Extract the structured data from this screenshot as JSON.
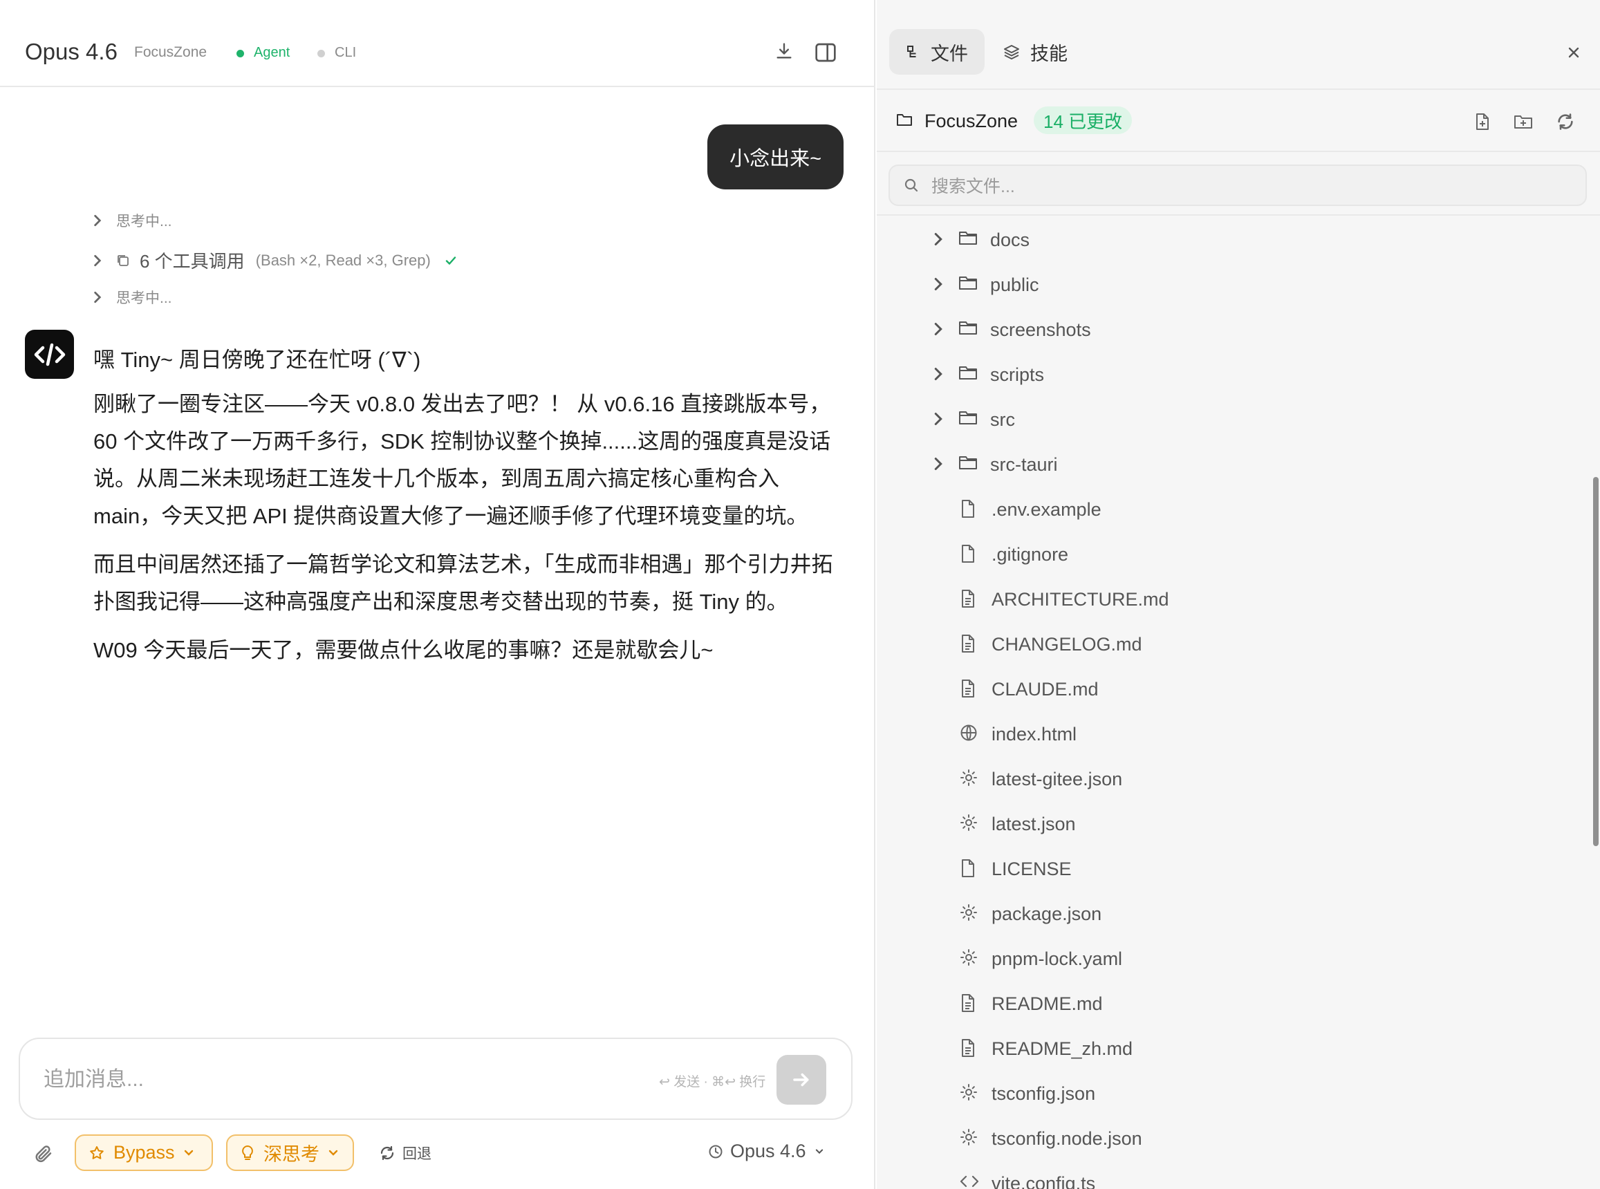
{
  "header": {
    "model": "Opus 4.6",
    "project": "FocusZone",
    "mode_agent": "Agent",
    "mode_cli": "CLI",
    "agent_color": "#1fb36b"
  },
  "conversation": {
    "user_message": "小念出来~",
    "trace": {
      "thinking_1": "思考中...",
      "tools_label": "6 个工具调用",
      "tools_detail": "(Bash ×2, Read ×3, Grep)",
      "thinking_2": "思考中..."
    },
    "assistant_paragraphs": [
      "嘿 Tiny~ 周日傍晚了还在忙呀 (´∇`)",
      "刚瞅了一圈专注区——今天 v0.8.0 发出去了吧？！ 从 v0.6.16 直接跳版本号，60 个文件改了一万两千多行，SDK 控制协议整个换掉......这周的强度真是没话说。从周二米未现场赶工连发十几个版本，到周五周六搞定核心重构合入 main，今天又把 API 提供商设置大修了一遍还顺手修了代理环境变量的坑。",
      "而且中间居然还插了一篇哲学论文和算法艺术，「生成而非相遇」那个引力井拓扑图我记得——这种高强度产出和深度思考交替出现的节奏，挺 Tiny 的。",
      "W09 今天最后一天了，需要做点什么收尾的事嘛？还是就歇会儿~"
    ]
  },
  "composer": {
    "placeholder": "追加消息...",
    "hint": "↩ 发送 · ⌘↩ 换行",
    "bypass_label": "Bypass",
    "deep_think_label": "深思考",
    "rollback_label": "回退",
    "model_select": "Opus 4.6"
  },
  "panel": {
    "tab_files": "文件",
    "tab_skills": "技能",
    "project_name": "FocusZone",
    "changes_badge": "14 已更改",
    "search_placeholder": "搜索文件...",
    "tree": [
      {
        "name": "docs",
        "type": "folder",
        "icon": "folder-icon"
      },
      {
        "name": "public",
        "type": "folder",
        "icon": "folder-icon"
      },
      {
        "name": "screenshots",
        "type": "folder",
        "icon": "folder-icon"
      },
      {
        "name": "scripts",
        "type": "folder",
        "icon": "folder-icon"
      },
      {
        "name": "src",
        "type": "folder",
        "icon": "folder-icon"
      },
      {
        "name": "src-tauri",
        "type": "folder",
        "icon": "folder-icon"
      },
      {
        "name": ".env.example",
        "type": "file",
        "icon": "file-icon"
      },
      {
        "name": ".gitignore",
        "type": "file",
        "icon": "file-icon"
      },
      {
        "name": "ARCHITECTURE.md",
        "type": "file",
        "icon": "doc-icon"
      },
      {
        "name": "CHANGELOG.md",
        "type": "file",
        "icon": "doc-icon"
      },
      {
        "name": "CLAUDE.md",
        "type": "file",
        "icon": "doc-icon"
      },
      {
        "name": "index.html",
        "type": "file",
        "icon": "globe-icon"
      },
      {
        "name": "latest-gitee.json",
        "type": "file",
        "icon": "gear-icon"
      },
      {
        "name": "latest.json",
        "type": "file",
        "icon": "gear-icon"
      },
      {
        "name": "LICENSE",
        "type": "file",
        "icon": "file-icon"
      },
      {
        "name": "package.json",
        "type": "file",
        "icon": "gear-icon"
      },
      {
        "name": "pnpm-lock.yaml",
        "type": "file",
        "icon": "gear-icon"
      },
      {
        "name": "README.md",
        "type": "file",
        "icon": "doc-icon"
      },
      {
        "name": "README_zh.md",
        "type": "file",
        "icon": "doc-icon"
      },
      {
        "name": "tsconfig.json",
        "type": "file",
        "icon": "gear-icon"
      },
      {
        "name": "tsconfig.node.json",
        "type": "file",
        "icon": "gear-icon"
      },
      {
        "name": "vite.config.ts",
        "type": "file",
        "icon": "code-icon"
      }
    ]
  },
  "colors": {
    "accent_green": "#1aaf66",
    "pill_orange": "#e08a00",
    "bubble_dark": "#2b2b2b"
  }
}
